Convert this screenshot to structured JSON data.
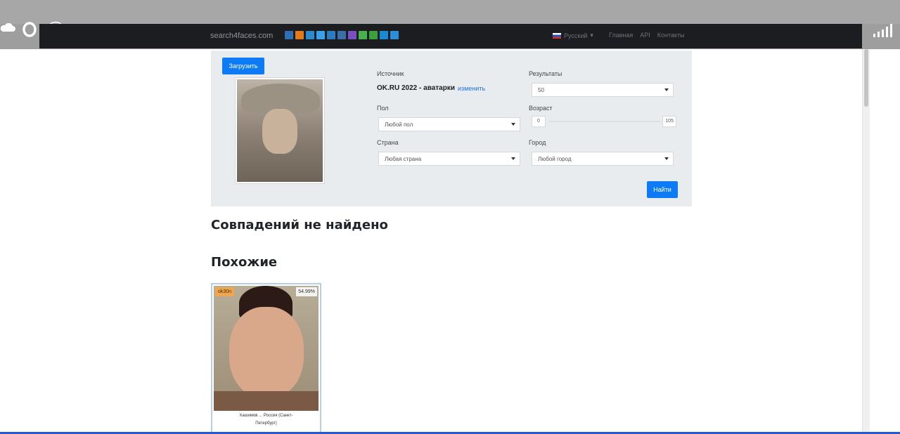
{
  "site": {
    "brand": "search4faces.com",
    "language": "Русский",
    "nav_links": [
      "Главная",
      "API",
      "Контакты"
    ],
    "social_colors": [
      "#2f6fb5",
      "#e07a1a",
      "#2a8bd0",
      "#3aa0e8",
      "#2a7bbf",
      "#3a6fa8",
      "#7a4fc4",
      "#48b04c",
      "#3c9e3c",
      "#1a8ad3",
      "#2a8fd8"
    ]
  },
  "form": {
    "upload_label": "Загрузить",
    "source_label": "Источник",
    "source_value": "OK.RU 2022 - аватарки",
    "source_change": "изменить",
    "results_label": "Результаты",
    "results_value": "50",
    "gender_label": "Пол",
    "gender_value": "Любой пол",
    "age_label": "Возраст",
    "age_min": "0",
    "age_max": "105",
    "country_label": "Страна",
    "country_value": "Любая страна",
    "city_label": "Город",
    "city_value": "Любой город",
    "search_label": "Найти"
  },
  "results": {
    "no_match": "Совпадений не найдено",
    "similar": "Похожие",
    "card": {
      "source_tag": "ok30n",
      "percent": "54.99%",
      "caption_line1": "Хашимов ... Россия (Санкт-",
      "caption_line2": "Петербург)"
    }
  },
  "colors": {
    "accent": "#0d7bf5",
    "navbar": "#1b1d20",
    "panel": "#e9ecef"
  }
}
